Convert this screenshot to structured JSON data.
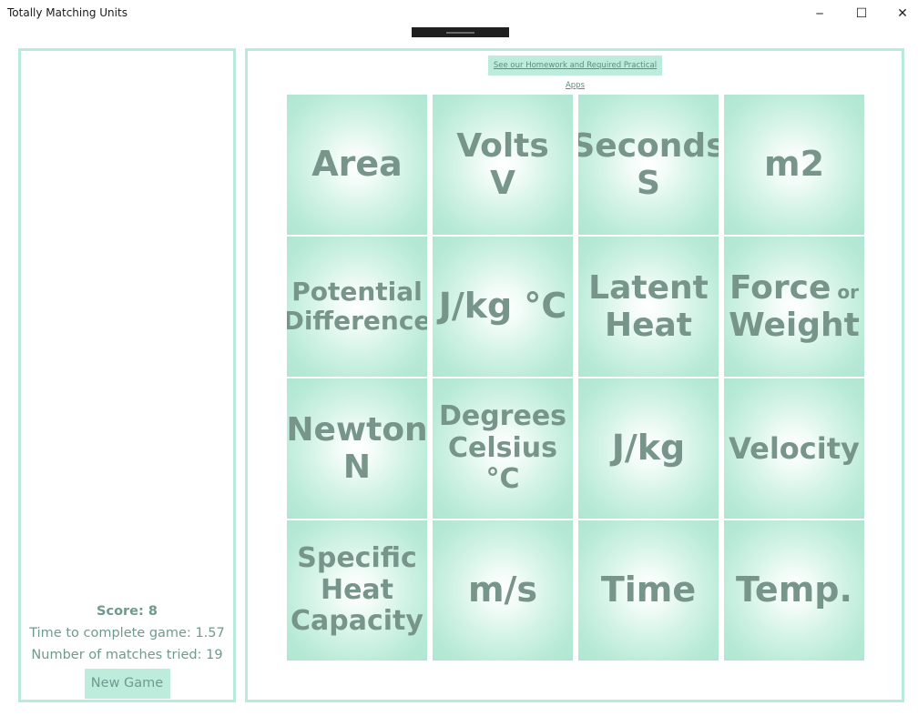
{
  "window": {
    "title": "Totally Matching Units",
    "minimize_glyph": "─",
    "maximize_glyph": "☐",
    "close_glyph": "✕"
  },
  "score_panel": {
    "score": "Score: 8",
    "time_to_complete": "Time to complete game: 1.57",
    "matches_tried": "Number of matches tried: 19",
    "new_game_label": "New Game"
  },
  "promo_link": "See our Homework and Required Practical Apps",
  "tiles": [
    {
      "lines": [
        "Area"
      ]
    },
    {
      "lines": [
        "Volts",
        "V"
      ]
    },
    {
      "lines": [
        "Seconds",
        "S"
      ]
    },
    {
      "lines": [
        "m2"
      ]
    },
    {
      "lines": [
        "Potential",
        "Difference"
      ]
    },
    {
      "lines": [
        "J/kg °C"
      ]
    },
    {
      "lines": [
        "Latent",
        "Heat"
      ]
    },
    {
      "lines": [
        "Force",
        "Weight"
      ],
      "connector": "or"
    },
    {
      "lines": [
        "Newton",
        "N"
      ]
    },
    {
      "lines": [
        "Degrees",
        "Celsius",
        "°C"
      ]
    },
    {
      "lines": [
        "J/kg"
      ]
    },
    {
      "lines": [
        "Velocity"
      ]
    },
    {
      "lines": [
        "Specific",
        "Heat",
        "Capacity"
      ]
    },
    {
      "lines": [
        "m/s"
      ]
    },
    {
      "lines": [
        "Time"
      ]
    },
    {
      "lines": [
        "Temp."
      ]
    }
  ],
  "colors": {
    "accent": "#b9eadb",
    "button_bg": "#bdebdc",
    "text": "#6f9a8f",
    "tile_text": "#77958b"
  }
}
